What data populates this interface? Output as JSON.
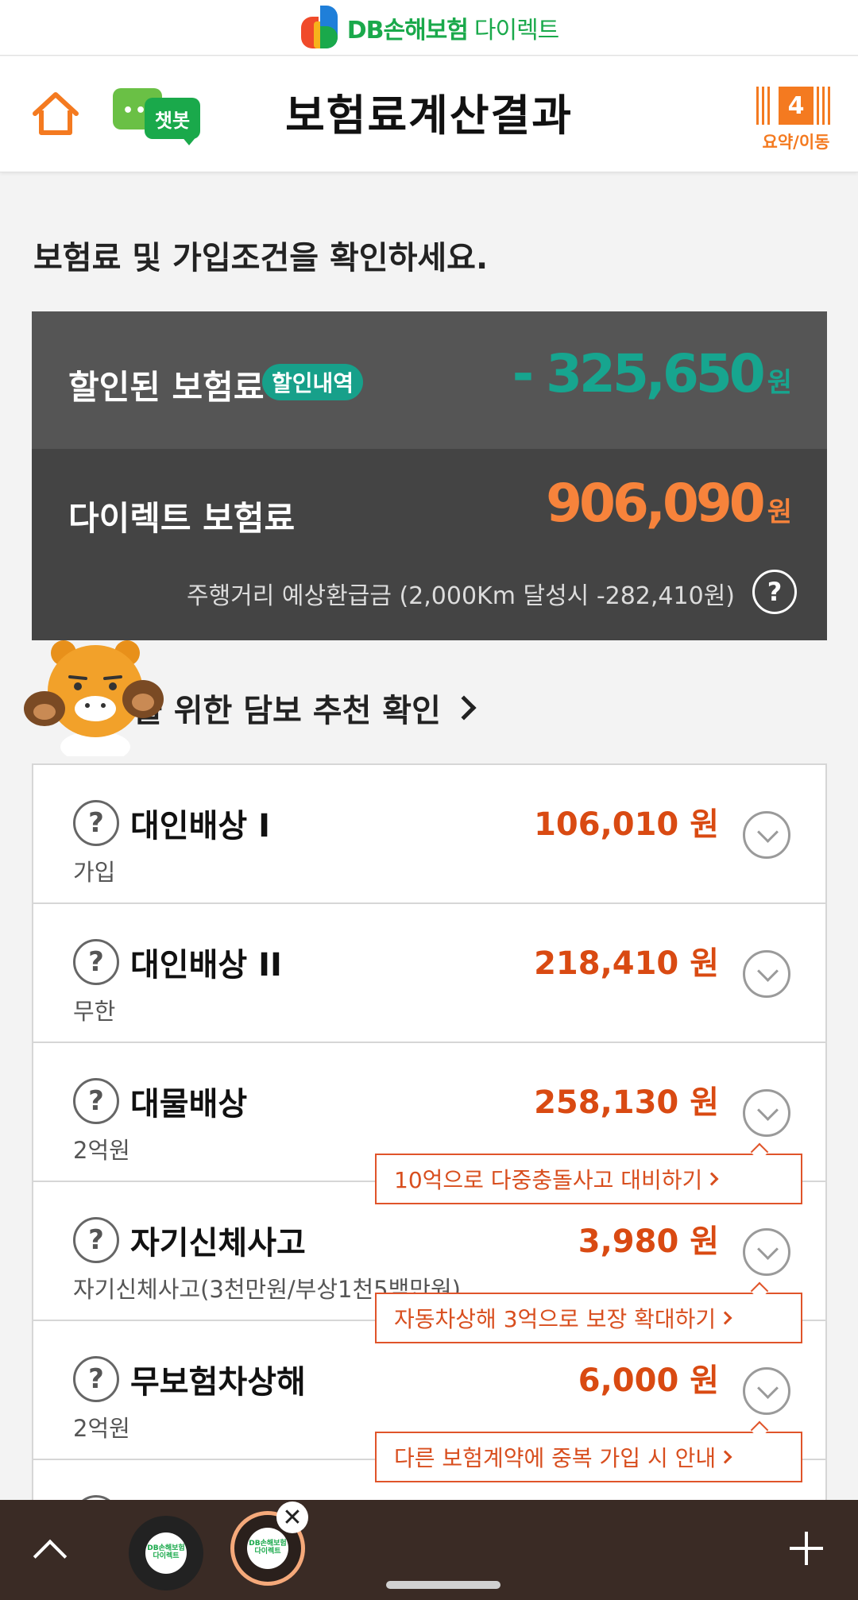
{
  "brand": {
    "name": "DB손해보험",
    "suffix": "다이렉트"
  },
  "header": {
    "title": "보험료계산결과",
    "chatbot_label": "챗봇",
    "step_number": "4",
    "step_label": "요약/이동"
  },
  "intro_text": "보험료 및 가입조건을 확인하세요.",
  "premium": {
    "discount_label": "할인된 보험료",
    "discount_badge": "할인내역",
    "discount_amount": "- 325,650",
    "discount_unit": "원",
    "direct_label": "다이렉트 보험료",
    "direct_amount": "906,090",
    "direct_unit": "원",
    "refund_note": "주행거리 예상환급금 (2,000Km 달성시 -282,410원)",
    "help_glyph": "?"
  },
  "recommend_text": "을 위한 담보 추천 확인",
  "coverages": [
    {
      "name": "대인배상 I",
      "sub": "가입",
      "price": "106,010 원"
    },
    {
      "name": "대인배상 II",
      "sub": "무한",
      "price": "218,410 원"
    },
    {
      "name": "대물배상",
      "sub": "2억원",
      "price": "258,130 원"
    },
    {
      "name": "자기신체사고",
      "sub": "자기신체사고(3천만원/부상1천5백만원)",
      "price": "3,980 원"
    },
    {
      "name": "무보험차상해",
      "sub": "2억원",
      "price": "6,000 원"
    }
  ],
  "tips": [
    "10억으로 다중충돌사고 대비하기",
    "자동차상해 3억으로 보장 확대하기",
    "다른 보험계약에 중복 가입 시 안내"
  ],
  "bottom_bar": {
    "tab_icon_text": "DB손해보험 다이렉트",
    "close_glyph": "✕"
  },
  "colors": {
    "accent_orange": "#f47a20",
    "discount_teal": "#17a58f",
    "price_red": "#d94a12",
    "brand_green": "#1aa94b"
  }
}
